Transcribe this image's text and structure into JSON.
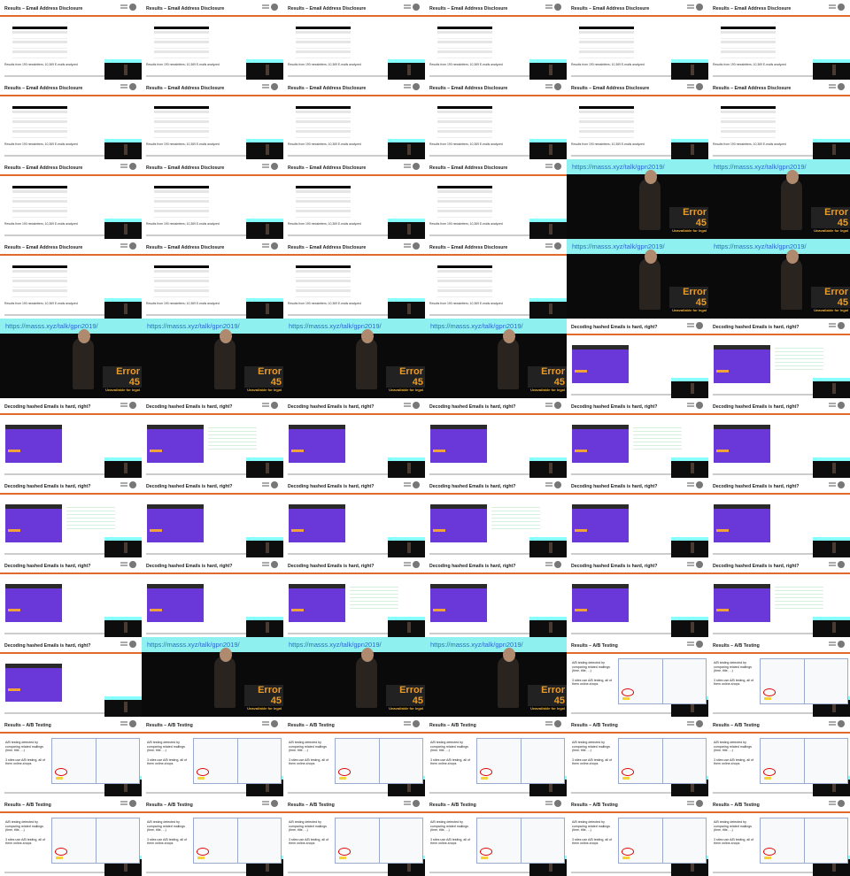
{
  "slides": {
    "email": {
      "title": "Results – Email Address Disclosure",
      "result": "Results from 190 newsletters; 10,369 E-mails analyzed"
    },
    "video": {
      "url": "https://masss.xyz/talk/gpn2019/",
      "error": "Error 45",
      "error_sub": "Unavailable for legal"
    },
    "hash": {
      "title": "Decoding hashed Emails is hard, right?"
    },
    "ab": {
      "title": "Results – A/B Testing",
      "text": "A/B testing detected by comparing related mailings (time, title, ...)",
      "text2": "3 sites use A/B testing, all of them online-shops"
    }
  },
  "grid": [
    [
      "email",
      "email",
      "email",
      "email",
      "email",
      "email"
    ],
    [
      "email",
      "email",
      "email",
      "email",
      "email",
      "email"
    ],
    [
      "email",
      "email",
      "email",
      "email",
      "video",
      "video"
    ],
    [
      "email",
      "email",
      "email",
      "email",
      "video",
      "video"
    ],
    [
      "video",
      "video",
      "video",
      "video",
      "hash",
      "hash"
    ],
    [
      "hash",
      "hash",
      "hash",
      "hash",
      "hash",
      "hash"
    ],
    [
      "hash",
      "hash",
      "hash",
      "hash",
      "hash",
      "hash"
    ],
    [
      "hash",
      "hash",
      "hash",
      "hash",
      "hash",
      "hash"
    ],
    [
      "hash",
      "video",
      "video",
      "video",
      "ab",
      "ab"
    ],
    [
      "ab",
      "ab",
      "ab",
      "ab",
      "ab",
      "ab"
    ],
    [
      "ab",
      "ab",
      "ab",
      "ab",
      "ab",
      "ab"
    ]
  ]
}
